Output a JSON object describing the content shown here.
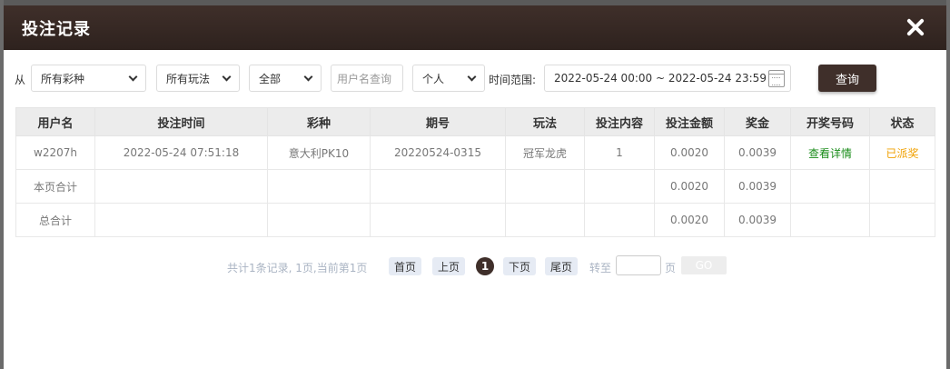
{
  "modal": {
    "title": "投注记录"
  },
  "filters": {
    "from_label": "从",
    "lottery_select": "所有彩种",
    "play_select": "所有玩法",
    "status_select": "全部",
    "username_placeholder": "用户名查询",
    "scope_select": "个人",
    "range_label": "时间范围:",
    "date_range": "2022-05-24 00:00 ~ 2022-05-24 23:59",
    "query_button": "查询"
  },
  "table": {
    "headers": [
      "用户名",
      "投注时间",
      "彩种",
      "期号",
      "玩法",
      "投注内容",
      "投注金额",
      "奖金",
      "开奖号码",
      "状态"
    ],
    "rows": [
      [
        "w2207h",
        "2022-05-24 07:51:18",
        "意大利PK10",
        "20220524-0315",
        "冠军龙虎",
        "1",
        "0.0020",
        "0.0039",
        "查看详情",
        "已派奖"
      ],
      [
        "本页合计",
        "",
        "",
        "",
        "",
        "",
        "0.0020",
        "0.0039",
        "",
        ""
      ],
      [
        "总合计",
        "",
        "",
        "",
        "",
        "",
        "0.0020",
        "0.0039",
        "",
        ""
      ]
    ]
  },
  "pager": {
    "info": "共计1条记录,  1页,当前第1页",
    "first": "首页",
    "prev": "上页",
    "current": "1",
    "next": "下页",
    "last": "尾页",
    "goto_label": "转至",
    "page_label": "页",
    "go": "GO"
  },
  "colors": {
    "header_bg": "#3f2f2a",
    "link": "#1a8c1a",
    "status": "#f0a000"
  }
}
